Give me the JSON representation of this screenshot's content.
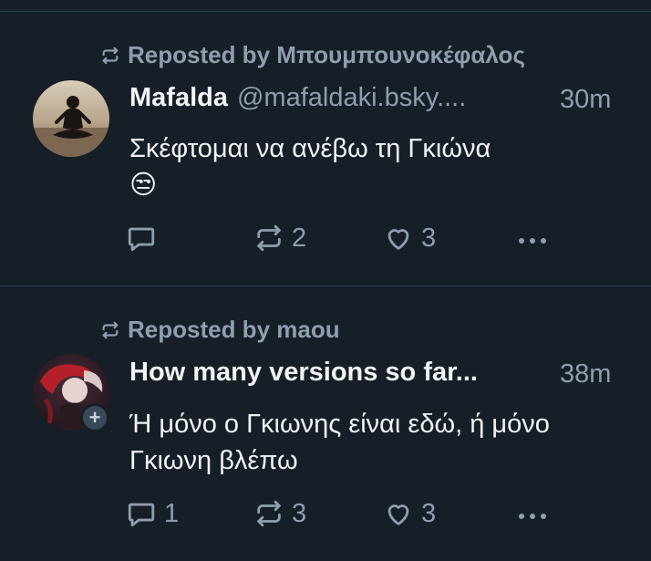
{
  "feed": [
    {
      "repost_label": "Reposted by Μπουμπουνοκέφαλος",
      "author": "Mafalda",
      "handle": "@mafaldaki.bsky....",
      "time": "30m",
      "text": "Σκέφτομαι να ανέβω τη Γκιώνα",
      "emoji": "😒",
      "replies": "",
      "reposts": "2",
      "likes": "3"
    },
    {
      "repost_label": "Reposted by maou",
      "author": "How many versions so far...",
      "handle": "",
      "time": "38m",
      "text": "Ή μόνο ο Γκιωνης είναι εδώ, ή μόνο Γκιωνη βλέπω",
      "replies": "1",
      "reposts": "3",
      "likes": "3"
    }
  ],
  "icons": {
    "repost": "repost-icon",
    "reply": "reply-icon",
    "like": "heart-icon",
    "more": "more-dots-icon",
    "follow": "plus-icon"
  },
  "colors": {
    "background": "#161e27",
    "muted_text": "#8f9eaf",
    "primary_text": "#f1f3f5",
    "divider": "#2e4052"
  }
}
